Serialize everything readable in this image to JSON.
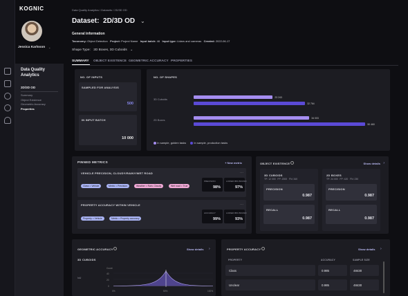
{
  "brand": "KOGNIC",
  "user": {
    "name": "Jessica Karlsson"
  },
  "nav": {
    "section_title": "Data Quality Analytics",
    "dataset_code": "2D/3D OD",
    "items": [
      "Summary",
      "Object Existence",
      "Geometric Accuracy",
      "Properties"
    ],
    "active": "Properties"
  },
  "breadcrumb": "Data Quality Analytics / Datasets / 2D/3D OD",
  "title": "Dataset:  2D/3D OD",
  "general": {
    "heading": "General information",
    "taxonomy_label": "Taxonomy:",
    "taxonomy": "Object Detection",
    "project_label": "Project:",
    "project": "Project Name",
    "batch_label": "Input batch:",
    "batch": "46",
    "input_type_label": "Input type:",
    "input_type": "Lidars and cameras",
    "created_label": "Created:",
    "created": "2022-06-17"
  },
  "shape_type": {
    "label": "Shape Type:",
    "value": "2D Boxes, 3D Cuboids"
  },
  "tabs": [
    "SUMMARY",
    "OBJECT EXISTENCE",
    "GEOMETRIC ACCURACY",
    "PROPERTIES"
  ],
  "inputs": {
    "heading": "NO. OF INPUTS",
    "sampled_label": "SAMPLED FOR ANALYSIS",
    "sampled_value": "500",
    "batch_label": "IN INPUT BATCH",
    "batch_value": "10 000"
  },
  "shapes": {
    "heading": "NO. OF SHAPES",
    "chart_data": {
      "type": "bar",
      "categories": [
        "3D Cuboids",
        "2D Boxes"
      ],
      "series": [
        {
          "name": "In sample, golden tasks",
          "values": [
            23243,
            34003
          ],
          "color": "#a58df0"
        },
        {
          "name": "In sample, production tasks",
          "values": [
            32764,
            50460
          ],
          "color": "#5b4ad6"
        }
      ],
      "value_labels": [
        [
          "23 243",
          "32 764"
        ],
        [
          "34 003",
          "50 460"
        ]
      ],
      "xlim": [
        0,
        52000
      ]
    }
  },
  "pinned": {
    "heading": "PINNED METRICS",
    "new_metric": "+ New metric",
    "metrics": [
      {
        "title": "VEHICLE PRECISION, CLOUDY/RAINY/WET ROAD",
        "chips": [
          "Class = Vehicle",
          "Metric = Precision",
          "Weather = Rain, Cloudy",
          "Wet road = True"
        ],
        "precision_label": "PRECISION",
        "precision": "98%",
        "lower_label": "LOWER 95% BOUND",
        "lower": "97%"
      },
      {
        "title": "PROPERTY ACCURACY WITHIN VEHICLE",
        "chips": [
          "Property = Vehicle",
          "Metric = Property accuracy"
        ],
        "precision_label": "ACCURACY",
        "precision": "99%",
        "lower_label": "LOWER 95% BOUND",
        "lower": "93%"
      }
    ]
  },
  "existence": {
    "heading": "OBJECT EXISTENCE",
    "show": "Show details",
    "groups": [
      {
        "title": "3D CUBOIDS",
        "stats": "TP: 12 000   FP: 2000   FN: 340",
        "precision": "0.987",
        "recall": "0.987"
      },
      {
        "title": "2D BOXES",
        "stats": "TP: 24 000   FP: 420   FN: 230",
        "precision": "0.987",
        "recall": "0.987"
      }
    ],
    "precision_label": "PRECISION",
    "recall_label": "RECALL"
  },
  "geometric": {
    "heading": "GEOMETRIC ACCURACY",
    "show": "Show details",
    "sub": "3D CUBOIDS",
    "ylabel": "Count",
    "yticks": [
      "40",
      "20",
      "0"
    ],
    "left_label": "IoU",
    "xticks": [
      "0%",
      "50%",
      "100%"
    ]
  },
  "property": {
    "heading": "PROPERTY ACCURACY",
    "show": "Show details",
    "columns": [
      "PROPERTY",
      "ACCURACY",
      "SAMPLE SIZE"
    ],
    "rows": [
      {
        "property": "Class",
        "accuracy": "0.985",
        "sample": "48430"
      },
      {
        "property": "Unclear",
        "accuracy": "0.985",
        "sample": "48430"
      }
    ]
  },
  "colors": {
    "accent": "#6e5ae6",
    "chip_blue": "#aab4f5",
    "chip_pink": "#f0a9d6",
    "link": "#b9b9f2"
  }
}
